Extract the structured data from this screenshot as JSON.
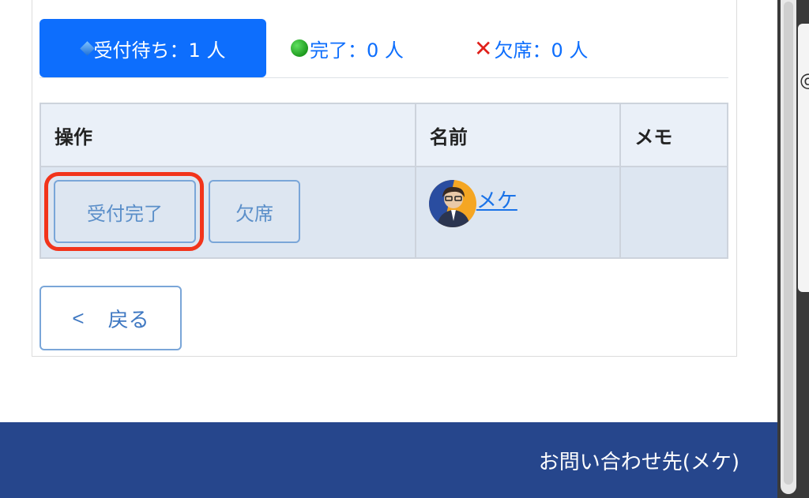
{
  "tabs": [
    {
      "label": "受付待ち：1 人",
      "icon": "blue-diamond-icon",
      "active": true
    },
    {
      "label": "完了：0 人",
      "icon": "green-circle-icon",
      "active": false
    },
    {
      "label": "欠席：0 人",
      "icon": "red-cross-icon",
      "active": false
    }
  ],
  "table": {
    "headers": [
      "操作",
      "名前",
      "メモ"
    ],
    "rows": [
      {
        "complete_button": "受付完了",
        "absent_button": "欠席",
        "name": " メケ",
        "memo": ""
      }
    ]
  },
  "back_button": {
    "arrow": "<",
    "label": "戻る"
  },
  "footer": {
    "contact": "お問い合わせ先(メケ)"
  },
  "peek": {
    "char": "@"
  },
  "colors": {
    "primary": "#0d6efd",
    "footer_bg": "#26468c",
    "highlight": "#f2341b",
    "row_bg": "#dde6f1",
    "header_bg": "#eaf0f8"
  }
}
